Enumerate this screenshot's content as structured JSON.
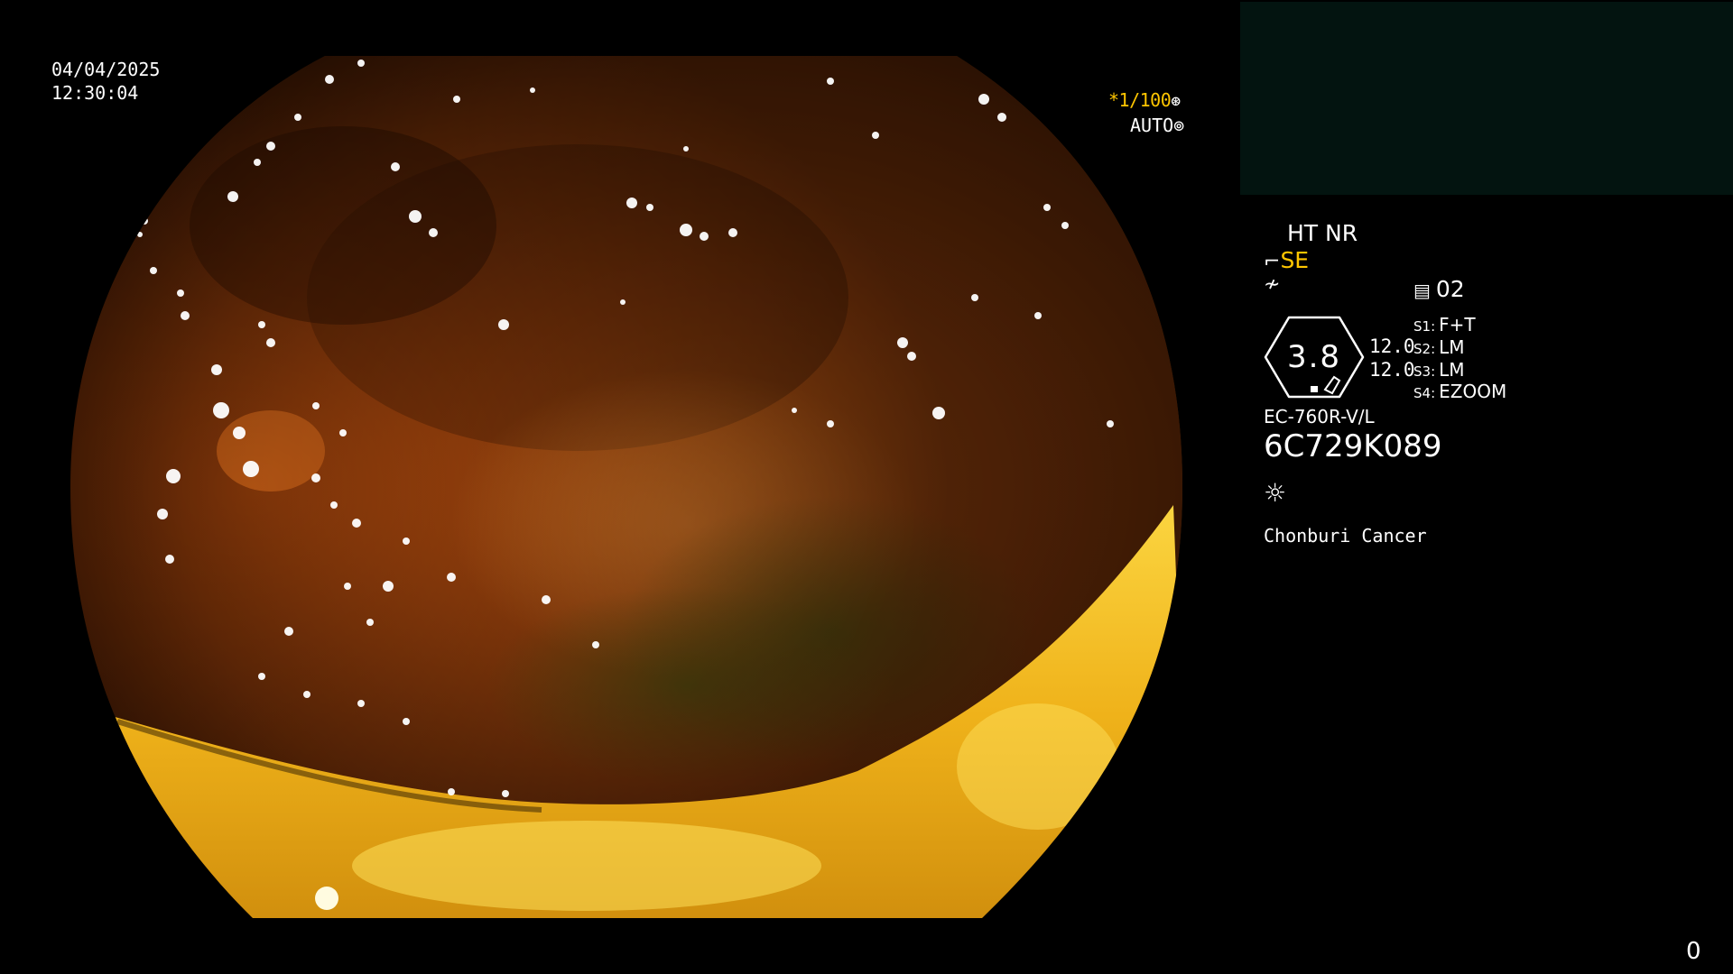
{
  "overlay": {
    "date": "04/04/2025",
    "time": "12:30:04",
    "shutter": "*1/100",
    "iris": "AUTO"
  },
  "panel": {
    "enhancement": "HT NR",
    "mode": "SE",
    "memory": "02",
    "gauge_value": "3.8",
    "value_1": "12.0",
    "value_2": "12.0",
    "switches": [
      {
        "key": "S1:",
        "value": "F+T"
      },
      {
        "key": "S2:",
        "value": "LM"
      },
      {
        "key": "S3:",
        "value": "LM"
      },
      {
        "key": "S4:",
        "value": "EZOOM"
      }
    ],
    "scope_model": "EC-760R-V/L",
    "scope_serial": "6C729K089",
    "site": "Chonburi Cancer"
  },
  "frame_counter": "0",
  "colors": {
    "accent_yellow": "#ffc600",
    "thumbnail_bg": "#031410",
    "mucosa_dark": "#5a2406",
    "mucosa_mid": "#a0420d",
    "fluid_yellow": "#f4c21c"
  },
  "icons": [
    "shutter-icon",
    "iris-icon",
    "structure-enhance-icon",
    "freeze-icon",
    "memory-icon",
    "light-source-icon"
  ]
}
